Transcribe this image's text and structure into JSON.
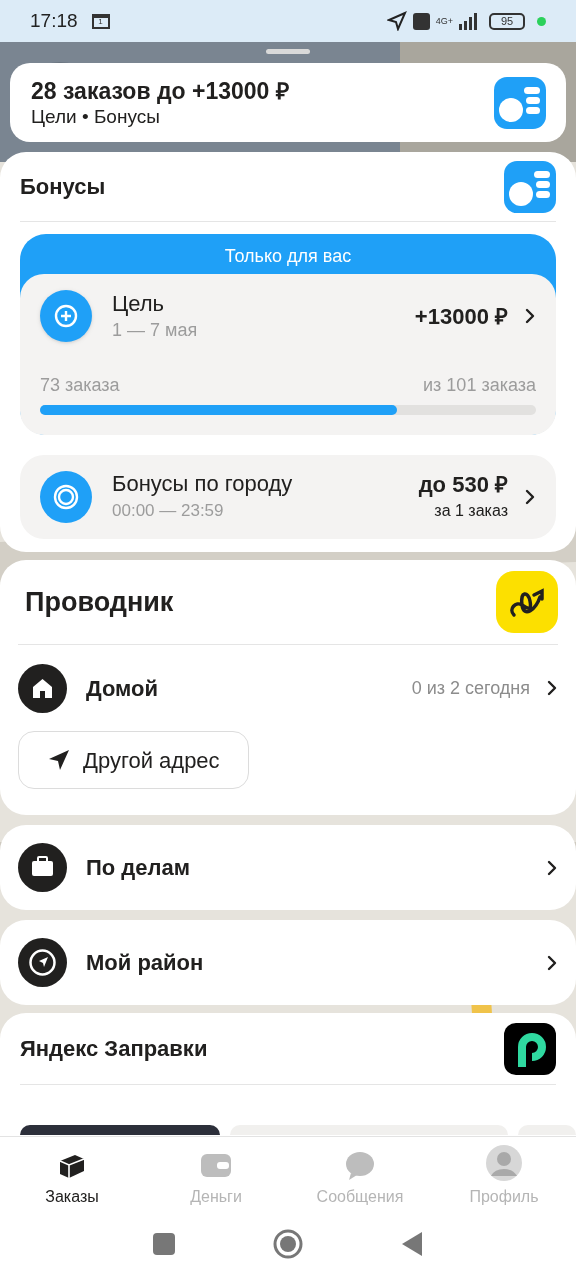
{
  "status_bar": {
    "time": "17:18",
    "calendar_day": "1",
    "network": "4G+",
    "battery": "95"
  },
  "goal_banner": {
    "title": "28 заказов до +13000 ₽",
    "subtitle": "Цели • Бонусы"
  },
  "bonuses": {
    "title": "Бонусы",
    "ribbon": "Только для вас",
    "goal": {
      "title": "Цель",
      "dates": "1 — 7 мая",
      "amount": "+13000 ₽",
      "done": "73 заказа",
      "total": "из 101 заказа",
      "level": 0.72
    },
    "city": {
      "title": "Бонусы по городу",
      "hours": "00:00 — 23:59",
      "amount": "до 530 ₽",
      "per": "за 1 заказ"
    }
  },
  "guide": {
    "title": "Проводник",
    "home": {
      "label": "Домой",
      "count": "0 из 2 сегодня"
    },
    "other_address": "Другой адрес"
  },
  "rows": [
    {
      "kind": "briefcase",
      "label": "По делам"
    },
    {
      "kind": "compass",
      "label": "Мой район"
    }
  ],
  "fuel": {
    "title": "Яндекс Заправки"
  },
  "tabs": [
    {
      "kind": "orders",
      "label": "Заказы",
      "selected": true
    },
    {
      "kind": "money",
      "label": "Деньги",
      "selected": false
    },
    {
      "kind": "messages",
      "label": "Сообщения",
      "selected": false
    },
    {
      "kind": "profile",
      "label": "Профиль",
      "selected": false
    }
  ]
}
